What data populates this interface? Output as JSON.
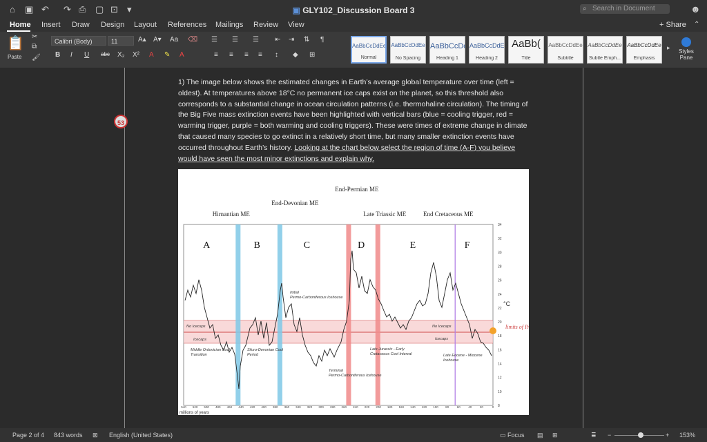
{
  "window": {
    "title": "GLY102_Discussion Board 3",
    "search_placeholder": "Search in Document"
  },
  "tabs": [
    "Home",
    "Insert",
    "Draw",
    "Design",
    "Layout",
    "References",
    "Mailings",
    "Review",
    "View"
  ],
  "share_label": "Share",
  "ribbon": {
    "paste_label": "Paste",
    "font_name": "Calibri (Body)",
    "font_size": "11",
    "styles": [
      {
        "sample": "AaBbCcDdEe",
        "name": "Normal"
      },
      {
        "sample": "AaBbCcDdEe",
        "name": "No Spacing"
      },
      {
        "sample": "AaBbCcDc",
        "name": "Heading 1"
      },
      {
        "sample": "AaBbCcDdE",
        "name": "Heading 2"
      },
      {
        "sample": "AaBb(",
        "name": "Title"
      },
      {
        "sample": "AaBbCcDdEe",
        "name": "Subtitle"
      },
      {
        "sample": "AaBbCcDdEe",
        "name": "Subtle Emph..."
      },
      {
        "sample": "AaBbCcDdEe",
        "name": "Emphasis"
      }
    ],
    "styles_pane_label": "Styles Pane"
  },
  "document": {
    "comment_count": "53",
    "question_text": "1) The image below shows the estimated changes in Earth’s average global temperature over time (left = oldest). At temperatures above 18°C no permanent ice caps exist on the planet, so this threshold also corresponds to a substantial change in ocean circulation patterns (i.e. thermohaline circulation). The timing of the Big Five mass extinction events have been highlighted with vertical bars (blue = cooling trigger, red = warming trigger, purple = both warming and cooling triggers). These were times of extreme change in climate that caused many species to go extinct in a relatively short time, but many smaller extinction events have occurred throughout Earth’s history.",
    "question_underlined": "Looking at the chart below select the region of time (A-F) you believe would have seen the most minor extinctions and explain why."
  },
  "chart_data": {
    "type": "line",
    "title": "",
    "xlabel": "millions of years",
    "ylabel": "°C",
    "x_ticks": [
      540,
      520,
      500,
      480,
      460,
      440,
      420,
      400,
      380,
      360,
      340,
      320,
      300,
      280,
      260,
      240,
      220,
      200,
      180,
      160,
      140,
      120,
      100,
      80,
      60,
      40,
      20,
      0
    ],
    "y_ticks": [
      8,
      10,
      12,
      14,
      16,
      18,
      20,
      22,
      24,
      26,
      28,
      30,
      32,
      34
    ],
    "region_labels": [
      "A",
      "B",
      "C",
      "D",
      "E",
      "F"
    ],
    "events": [
      {
        "name": "Hirnantian ME",
        "trigger": "cooling",
        "color": "#7fc8e6"
      },
      {
        "name": "End-Devonian ME",
        "trigger": "cooling",
        "color": "#7fc8e6"
      },
      {
        "name": "End-Permian ME",
        "trigger": "warming",
        "color": "#f08a8a"
      },
      {
        "name": "Late Triassic ME",
        "trigger": "warming",
        "color": "#f08a8a"
      },
      {
        "name": "End Cretaceous ME",
        "trigger": "both",
        "color": "#b27fe6"
      }
    ],
    "annotations": [
      "No Icecaps",
      "Icecaps",
      "Middle Ordovician Cool Transition",
      "Siluro-Devonian Cool Period",
      "Initial Permo-Carboniferous Icehouse",
      "Terminal Permo-Carboniferous Icehouse",
      "Late Jurassic - Early Cretaceous Cool Interval",
      "No Icecaps",
      "Icecaps",
      "Late Eocene - Miocene Icehouse",
      "limits of PAW"
    ]
  },
  "status": {
    "page": "Page 2 of 4",
    "words": "843 words",
    "language": "English (United States)",
    "focus": "Focus",
    "zoom": "153%"
  }
}
